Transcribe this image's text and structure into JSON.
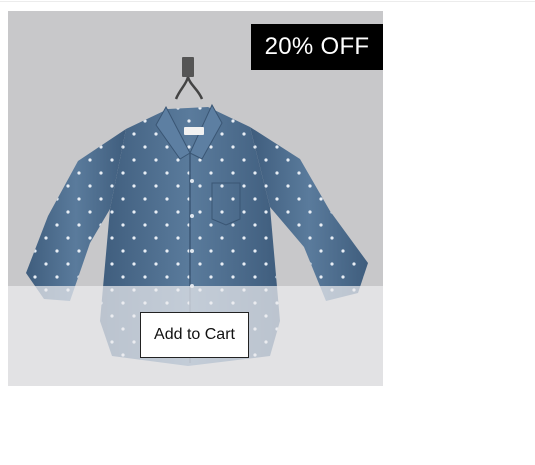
{
  "product": {
    "image_subject": "denim-button-up-shirt-on-hanger",
    "discount_badge": "20% OFF",
    "add_to_cart_label": "Add to Cart"
  },
  "colors": {
    "backdrop": "#c8c8ca",
    "badge_bg": "#000000",
    "badge_text": "#ffffff",
    "shirt": "#4f6f91"
  }
}
